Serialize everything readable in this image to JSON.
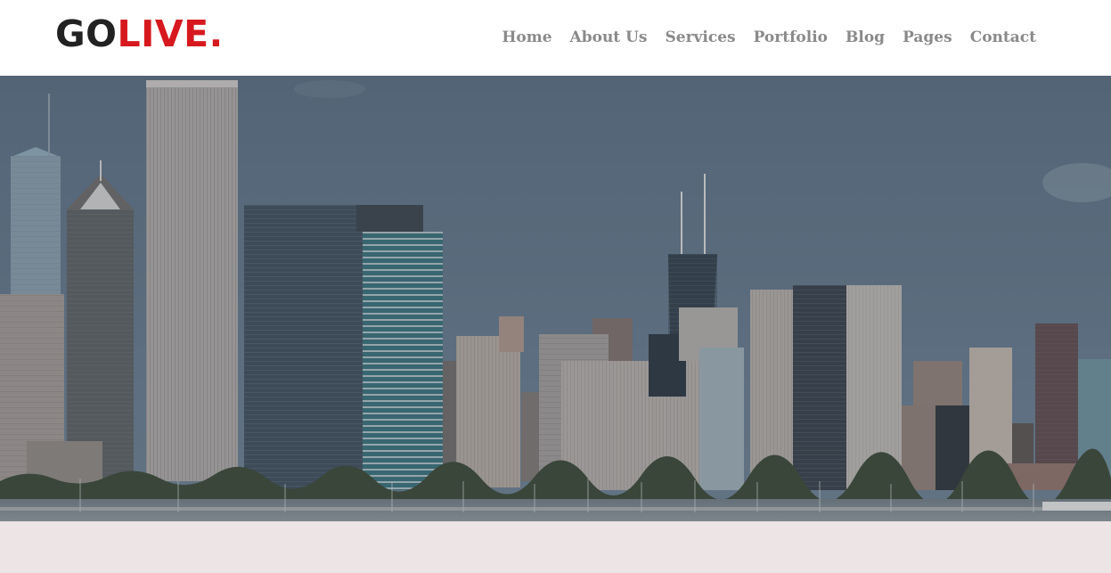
{
  "logo": {
    "part1": "GO",
    "part2": "LIVE",
    "dot": "."
  },
  "nav": {
    "items": [
      {
        "label": "Home"
      },
      {
        "label": "About Us"
      },
      {
        "label": "Services"
      },
      {
        "label": "Portfolio"
      },
      {
        "label": "Blog"
      },
      {
        "label": "Pages"
      },
      {
        "label": "Contact"
      }
    ]
  },
  "colors": {
    "brand_red": "#d7191f",
    "logo_dark": "#222222",
    "nav_text": "#8a8a8a",
    "sky": "#5d7184",
    "below_band": "#ece4e5"
  },
  "hero": {
    "image": "city-skyline-image"
  }
}
